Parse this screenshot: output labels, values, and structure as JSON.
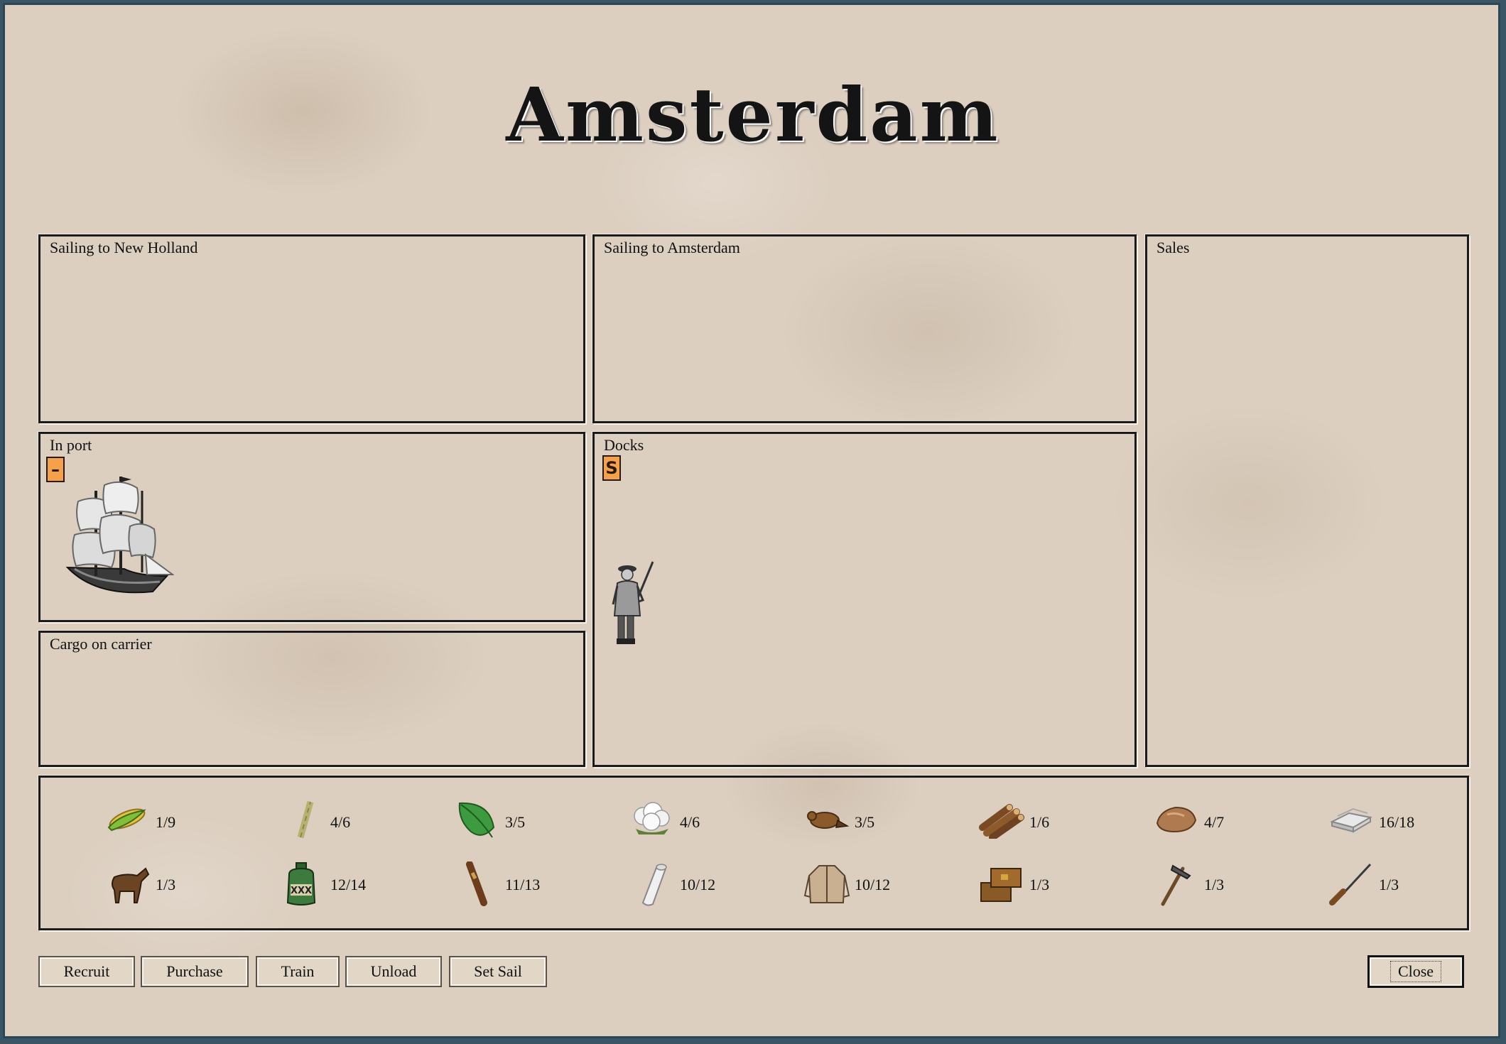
{
  "title": "Amsterdam",
  "panels": {
    "sailing_to_colony": "Sailing to New Holland",
    "sailing_to_europe": "Sailing to Amsterdam",
    "sales": "Sales",
    "in_port": "In port",
    "docks": "Docks",
    "cargo": "Cargo on carrier"
  },
  "in_port_badge": "–",
  "docks_badge": "S",
  "goods": [
    {
      "name": "food-icon",
      "count": "1/9"
    },
    {
      "name": "sugar-icon",
      "count": "4/6"
    },
    {
      "name": "tobacco-icon",
      "count": "3/5"
    },
    {
      "name": "cotton-icon",
      "count": "4/6"
    },
    {
      "name": "furs-icon",
      "count": "3/5"
    },
    {
      "name": "lumber-icon",
      "count": "1/6"
    },
    {
      "name": "ore-icon",
      "count": "4/7"
    },
    {
      "name": "silver-icon",
      "count": "16/18"
    },
    {
      "name": "horses-icon",
      "count": "1/3"
    },
    {
      "name": "rum-icon",
      "count": "12/14"
    },
    {
      "name": "cigars-icon",
      "count": "11/13"
    },
    {
      "name": "cloth-icon",
      "count": "10/12"
    },
    {
      "name": "coats-icon",
      "count": "10/12"
    },
    {
      "name": "trade-goods-icon",
      "count": "1/3"
    },
    {
      "name": "tools-icon",
      "count": "1/3"
    },
    {
      "name": "muskets-icon",
      "count": "1/3"
    }
  ],
  "buttons": {
    "recruit": "Recruit",
    "purchase": "Purchase",
    "train": "Train",
    "unload": "Unload",
    "set_sail": "Set Sail",
    "close": "Close"
  }
}
